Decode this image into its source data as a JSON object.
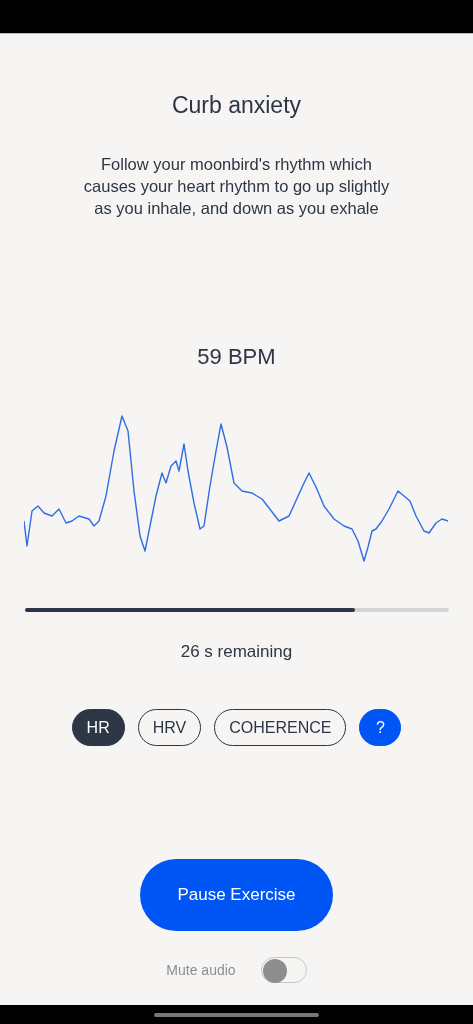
{
  "title": "Curb anxiety",
  "description": "Follow your moonbird's rhythm which causes your heart rhythm to go up slightly as you inhale, and down as you exhale",
  "heart_rate": "59 BPM",
  "progress": {
    "level": 0.78
  },
  "remaining": "26 s remaining",
  "metric_tabs": [
    {
      "label": "HR",
      "selected": true
    },
    {
      "label": "HRV",
      "selected": false
    },
    {
      "label": "COHERENCE",
      "selected": false
    }
  ],
  "help_button": "?",
  "pause_button": "Pause Exercise",
  "mute": {
    "label": "Mute audio",
    "on": false
  }
}
